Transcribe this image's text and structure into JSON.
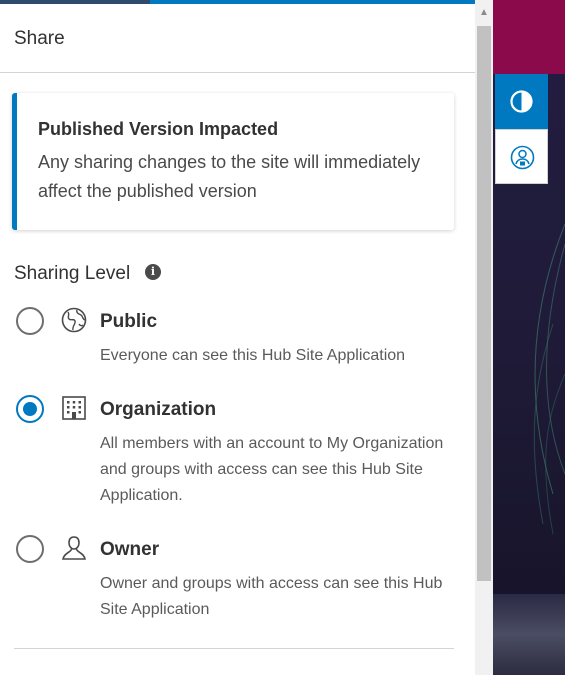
{
  "panel": {
    "title": "Share"
  },
  "notice": {
    "title": "Published Version Impacted",
    "body": "Any sharing changes to the site will immediately affect the published version"
  },
  "sharing": {
    "label": "Sharing Level",
    "info_icon": "info-icon",
    "selected": "Organization",
    "options": [
      {
        "title": "Public",
        "description": "Everyone can see this Hub Site Application",
        "icon": "globe-icon",
        "checked": false
      },
      {
        "title": "Organization",
        "description": "All members with an account to My Organization and groups with access can see this Hub Site Application.",
        "icon": "building-icon",
        "checked": true
      },
      {
        "title": "Owner",
        "description": "Owner and groups with access can see this Hub Site Application",
        "icon": "user-icon",
        "checked": false
      }
    ]
  },
  "tools": {
    "contrast_icon": "contrast-icon",
    "accessibility_icon": "user-lock-icon"
  },
  "colors": {
    "accent": "#0079c1",
    "backdrop_top": "#8a0a4b",
    "backdrop": "#1d1a3a",
    "text": "#323232"
  }
}
